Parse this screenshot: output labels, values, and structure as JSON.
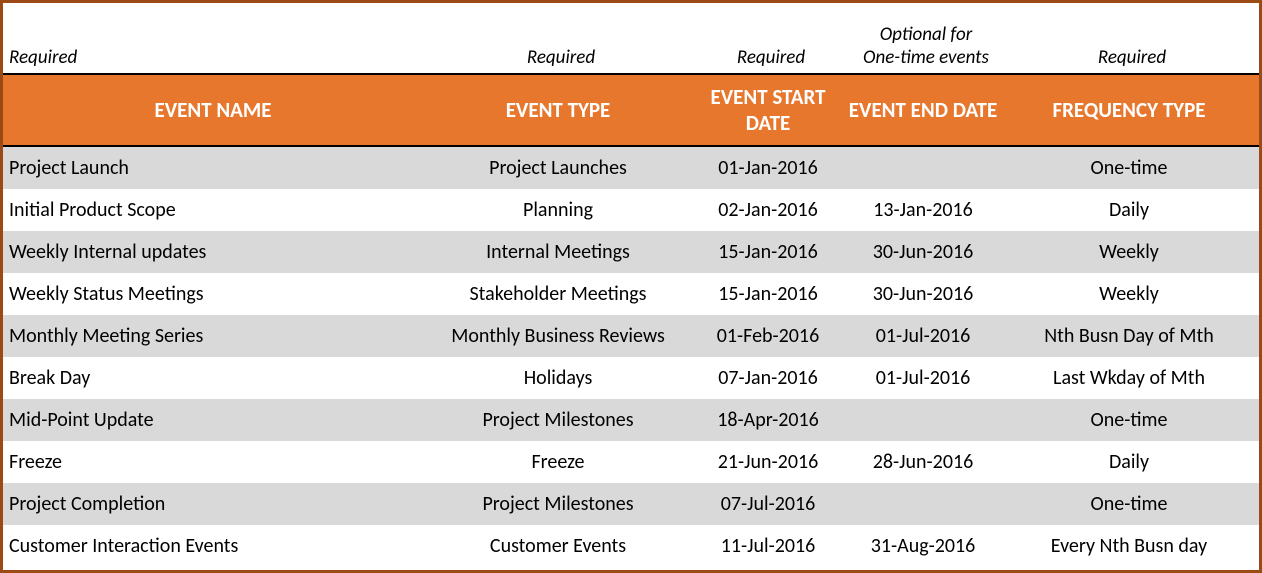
{
  "hints": {
    "name": "Required",
    "type": "Required",
    "start": "Required",
    "end": "Optional for\nOne-time events",
    "freq": "Required"
  },
  "headers": {
    "name": "EVENT NAME",
    "type": "EVENT TYPE",
    "start": "EVENT START DATE",
    "end": "EVENT END DATE",
    "freq": "FREQUENCY TYPE"
  },
  "rows": [
    {
      "name": "Project Launch",
      "type": "Project Launches",
      "start": "01-Jan-2016",
      "end": "",
      "freq": "One-time"
    },
    {
      "name": "Initial Product Scope",
      "type": "Planning",
      "start": "02-Jan-2016",
      "end": "13-Jan-2016",
      "freq": "Daily"
    },
    {
      "name": "Weekly Internal updates",
      "type": "Internal Meetings",
      "start": "15-Jan-2016",
      "end": "30-Jun-2016",
      "freq": "Weekly"
    },
    {
      "name": "Weekly Status Meetings",
      "type": "Stakeholder Meetings",
      "start": "15-Jan-2016",
      "end": "30-Jun-2016",
      "freq": "Weekly"
    },
    {
      "name": "Monthly Meeting Series",
      "type": "Monthly Business Reviews",
      "start": "01-Feb-2016",
      "end": "01-Jul-2016",
      "freq": "Nth Busn Day of Mth"
    },
    {
      "name": "Break Day",
      "type": "Holidays",
      "start": "07-Jan-2016",
      "end": "01-Jul-2016",
      "freq": "Last Wkday of Mth"
    },
    {
      "name": "Mid-Point Update",
      "type": "Project Milestones",
      "start": "18-Apr-2016",
      "end": "",
      "freq": "One-time"
    },
    {
      "name": "Freeze",
      "type": "Freeze",
      "start": "21-Jun-2016",
      "end": "28-Jun-2016",
      "freq": "Daily"
    },
    {
      "name": "Project Completion",
      "type": "Project Milestones",
      "start": "07-Jul-2016",
      "end": "",
      "freq": "One-time"
    },
    {
      "name": "Customer Interaction Events",
      "type": "Customer Events",
      "start": "11-Jul-2016",
      "end": "31-Aug-2016",
      "freq": "Every Nth Busn day"
    }
  ]
}
